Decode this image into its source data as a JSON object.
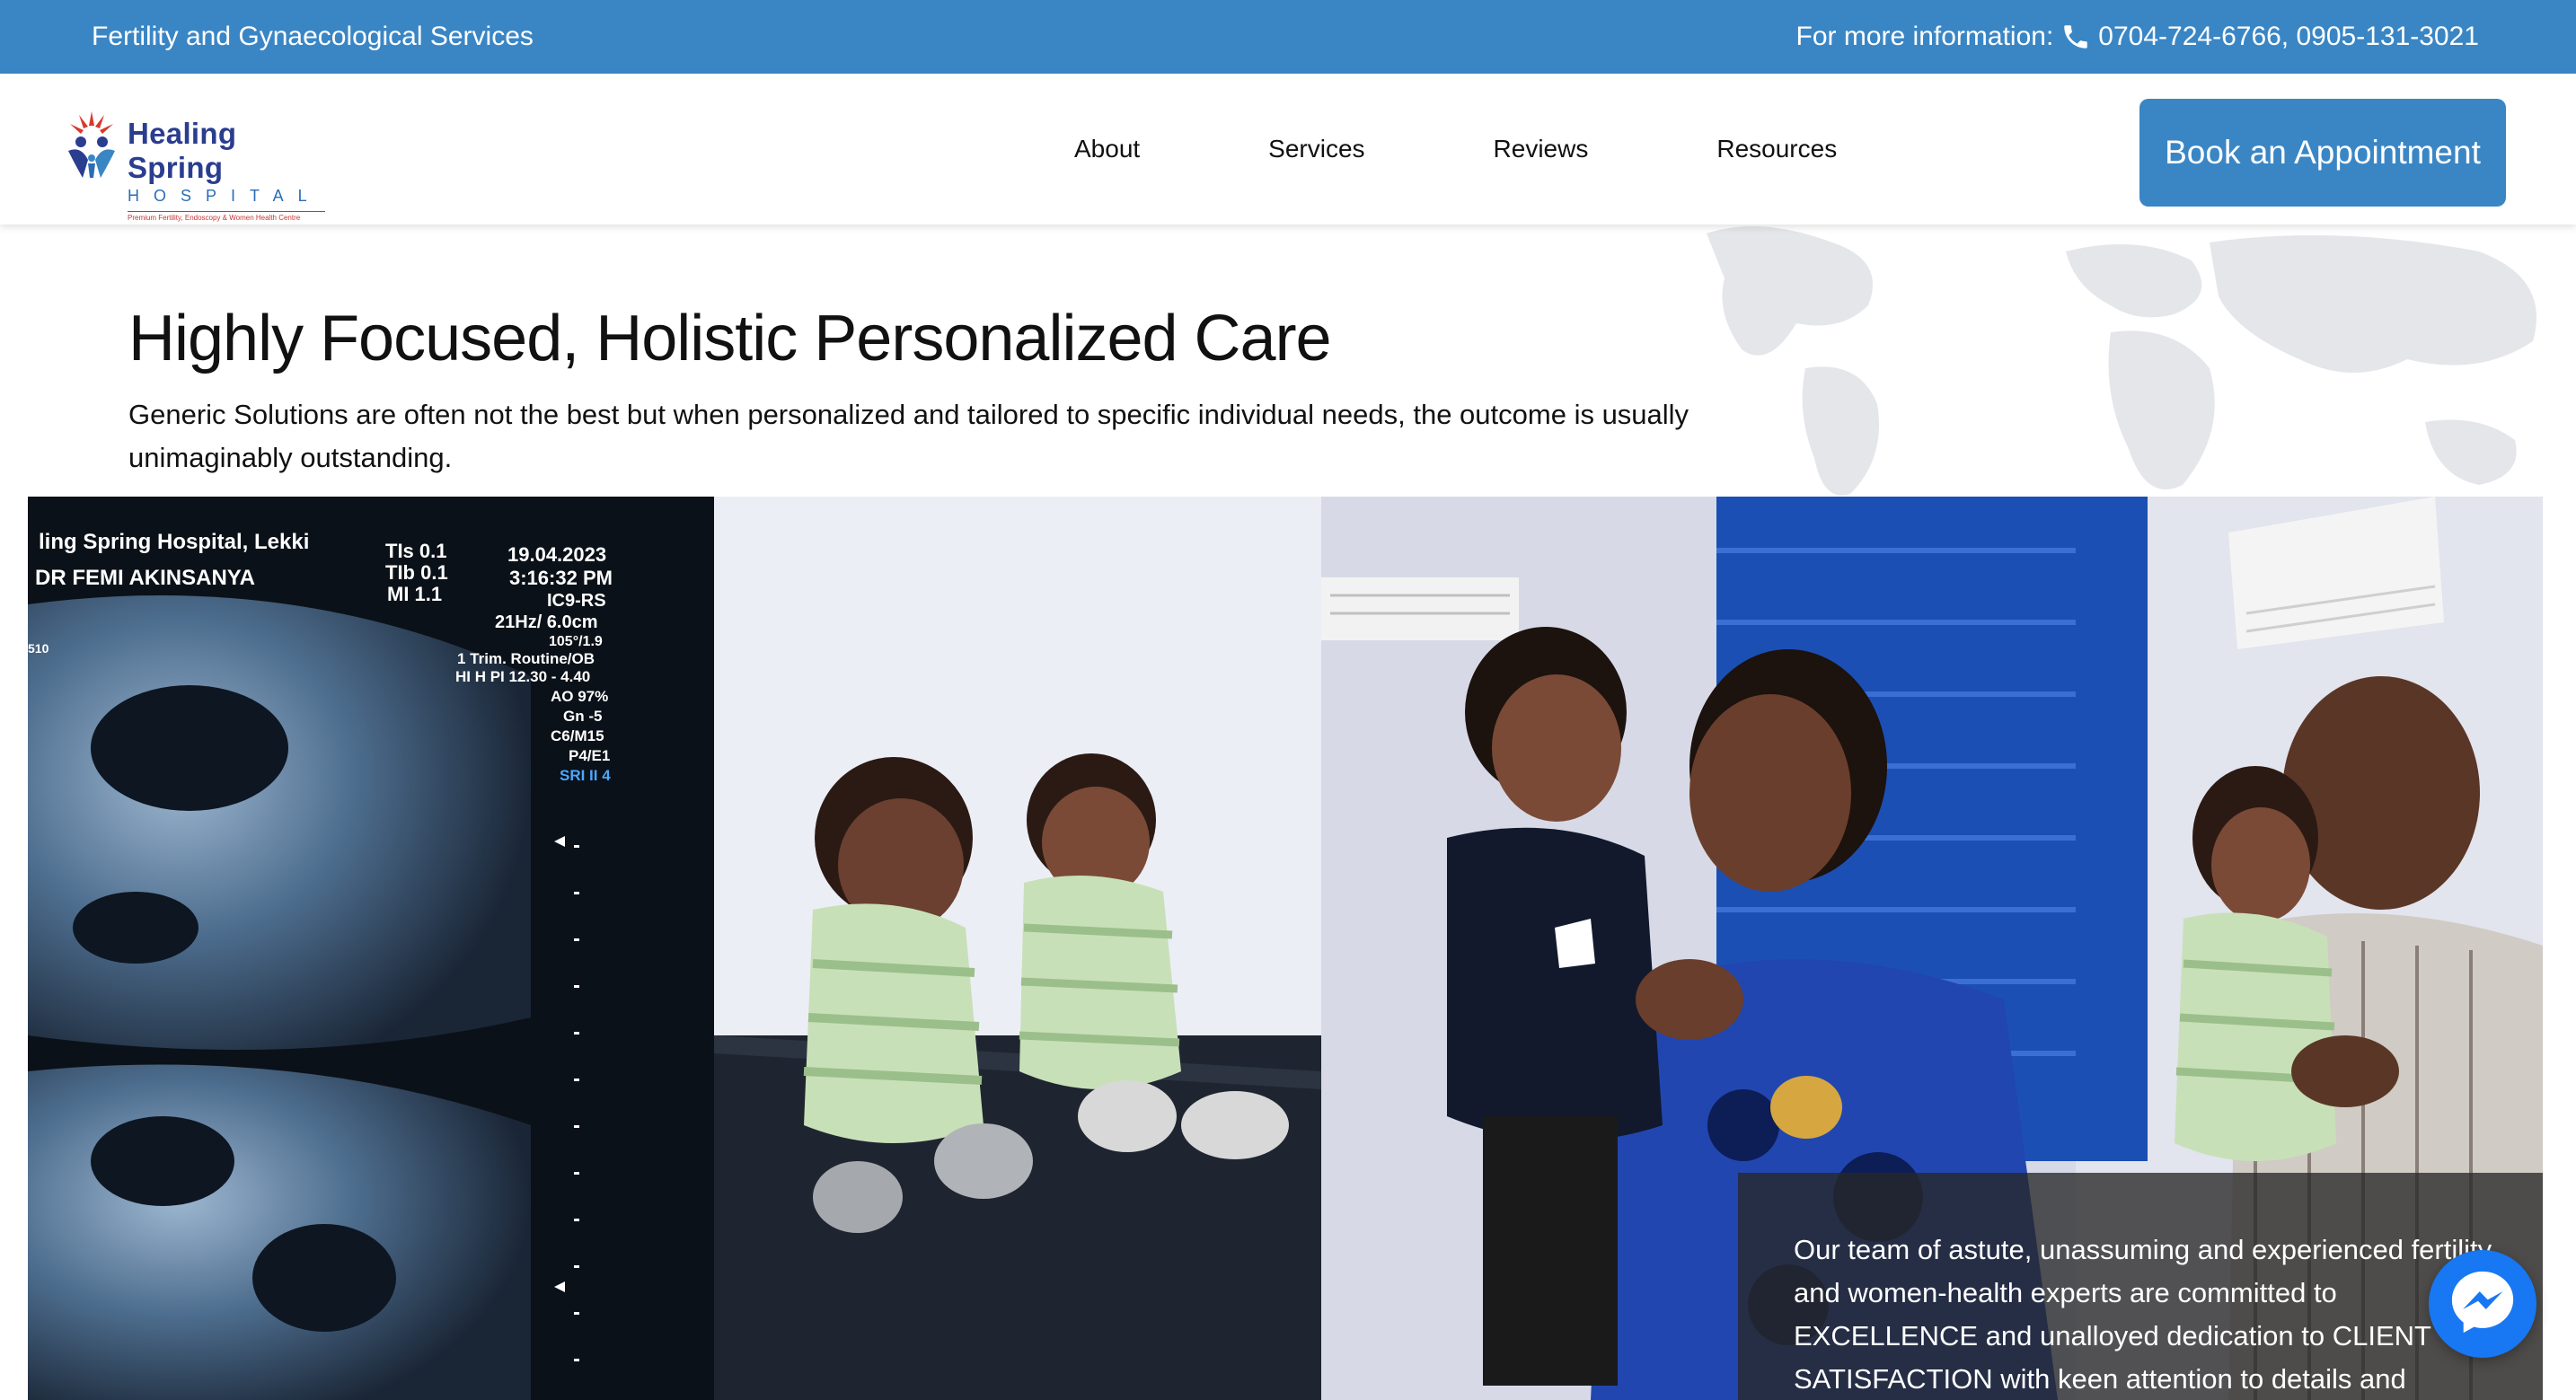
{
  "topbar": {
    "tagline": "Fertility and Gynaecological Services",
    "contact_label": "For more information:",
    "phones": "0704-724-6766, 0905-131-3021"
  },
  "logo": {
    "name": "Healing Spring",
    "sub": "HOSPITAL",
    "tagline": "Premium Fertility, Endoscopy & Women Health Centre"
  },
  "nav": {
    "items": [
      "About",
      "Services",
      "Reviews",
      "Resources"
    ]
  },
  "cta": {
    "label": "Book an Appointment"
  },
  "hero": {
    "title": "Highly Focused, Holistic Personalized Care",
    "description": "Generic Solutions are often not the best but when personalized and tailored to specific individual needs, the outcome is usually unimaginably outstanding."
  },
  "ultrasound": {
    "facility": "ling Spring Hospital, Lekki",
    "doctor": "DR FEMI AKINSANYA",
    "tis": "TIs  0.1",
    "tib": "TIb  0.1",
    "mi": "MI  1.1",
    "date": "19.04.2023",
    "time": "3:16:32 PM",
    "probe": "IC9-RS",
    "freq": "21Hz/ 6.0cm",
    "angle": "105°/1.9",
    "preset": "1 Trim. Routine/OB",
    "hh": "HI H PI 12.30 - 4.40",
    "ao": "AO 97%",
    "gn": "Gn -5",
    "cm": "C6/M15",
    "pe": "P4/E1",
    "sri": "SRI II 4",
    "side": "510"
  },
  "overlay": {
    "text": "Our team of astute, unassuming and experienced fertility and women-health experts are committed to EXCELLENCE and unalloyed dedication to CLIENT SATISFACTION with keen attention to details and"
  },
  "colors": {
    "brand_blue": "#3a86c5",
    "logo_navy": "#2b3d8f",
    "messenger_blue": "#1877f2"
  },
  "icons": [
    "phone-icon",
    "messenger-icon",
    "logo-mark-icon",
    "world-map-icon"
  ]
}
